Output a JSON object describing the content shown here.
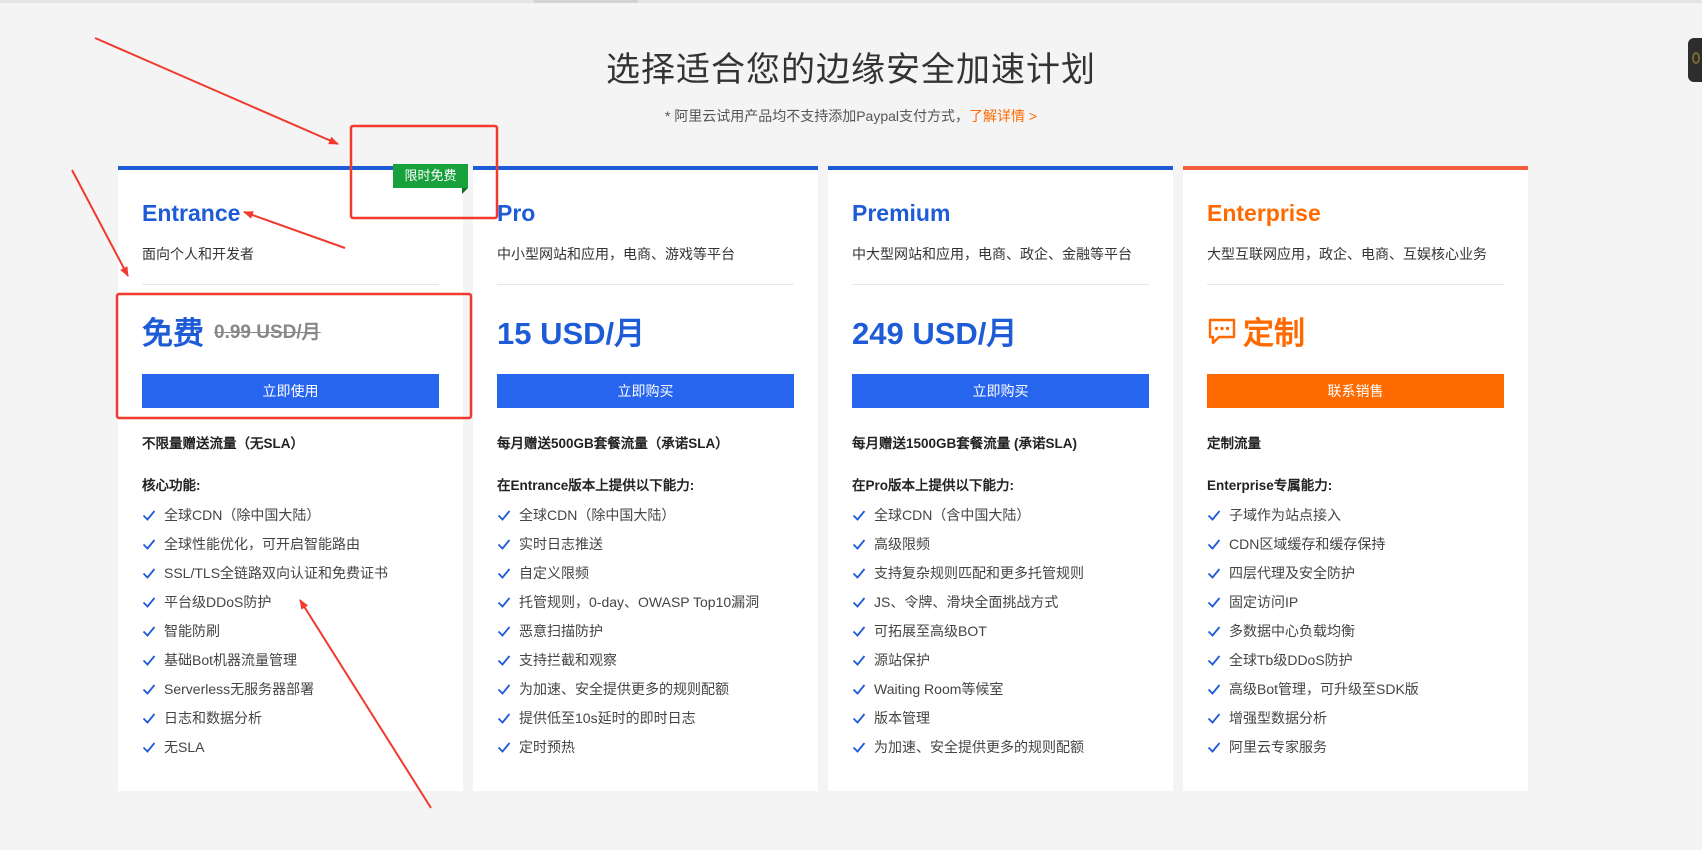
{
  "header": {
    "title": "选择适合您的边缘安全加速计划",
    "notice_text": "* 阿里云试用产品均不支持添加Paypal支付方式，",
    "notice_link": "了解详情 >"
  },
  "ribbon": {
    "label": "限时免费"
  },
  "plans": [
    {
      "name": "Entrance",
      "desc": "面向个人和开发者",
      "price": "免费",
      "old_price": "0.99 USD/月",
      "cta": "立即使用",
      "traffic": "不限量赠送流量（无SLA）",
      "features_title": "核心功能:",
      "features": [
        "全球CDN（除中国大陆）",
        "全球性能优化，可开启智能路由",
        "SSL/TLS全链路双向认证和免费证书",
        "平台级DDoS防护",
        "智能防刷",
        "基础Bot机器流量管理",
        "Serverless无服务器部署",
        "日志和数据分析",
        "无SLA"
      ]
    },
    {
      "name": "Pro",
      "desc": "中小型网站和应用，电商、游戏等平台",
      "price": "15 USD/月",
      "cta": "立即购买",
      "traffic": "每月赠送500GB套餐流量（承诺SLA）",
      "features_title": "在Entrance版本上提供以下能力:",
      "features": [
        "全球CDN（除中国大陆）",
        "实时日志推送",
        "自定义限频",
        "托管规则，0-day、OWASP Top10漏洞",
        "恶意扫描防护",
        "支持拦截和观察",
        "为加速、安全提供更多的规则配额",
        "提供低至10s延时的即时日志",
        "定时预热"
      ]
    },
    {
      "name": "Premium",
      "desc": "中大型网站和应用，电商、政企、金融等平台",
      "price": "249 USD/月",
      "cta": "立即购买",
      "traffic": "每月赠送1500GB套餐流量 (承诺SLA)",
      "features_title": "在Pro版本上提供以下能力:",
      "features": [
        "全球CDN（含中国大陆）",
        "高级限频",
        "支持复杂规则匹配和更多托管规则",
        "JS、令牌、滑块全面挑战方式",
        "可拓展至高级BOT",
        "源站保护",
        "Waiting Room等候室",
        "版本管理",
        "为加速、安全提供更多的规则配额"
      ]
    },
    {
      "name": "Enterprise",
      "desc": "大型互联网应用，政企、电商、互娱核心业务",
      "price": "定制",
      "icon": "chat-bubble-icon",
      "cta": "联系销售",
      "traffic": "定制流量",
      "features_title": "Enterprise专属能力:",
      "features": [
        "子域作为站点接入",
        "CDN区域缓存和缓存保持",
        "四层代理及安全防护",
        "固定访问IP",
        "多数据中心负载均衡",
        "全球Tb级DDoS防护",
        "高级Bot管理，可升级至SDK版",
        "增强型数据分析",
        "阿里云专家服务"
      ]
    }
  ],
  "colors": {
    "accent": "#1e5bd7",
    "button": "#2765ef",
    "enterprise": "#ff6a00",
    "ribbon": "#18a03d",
    "annotation": "#f03a2e"
  }
}
